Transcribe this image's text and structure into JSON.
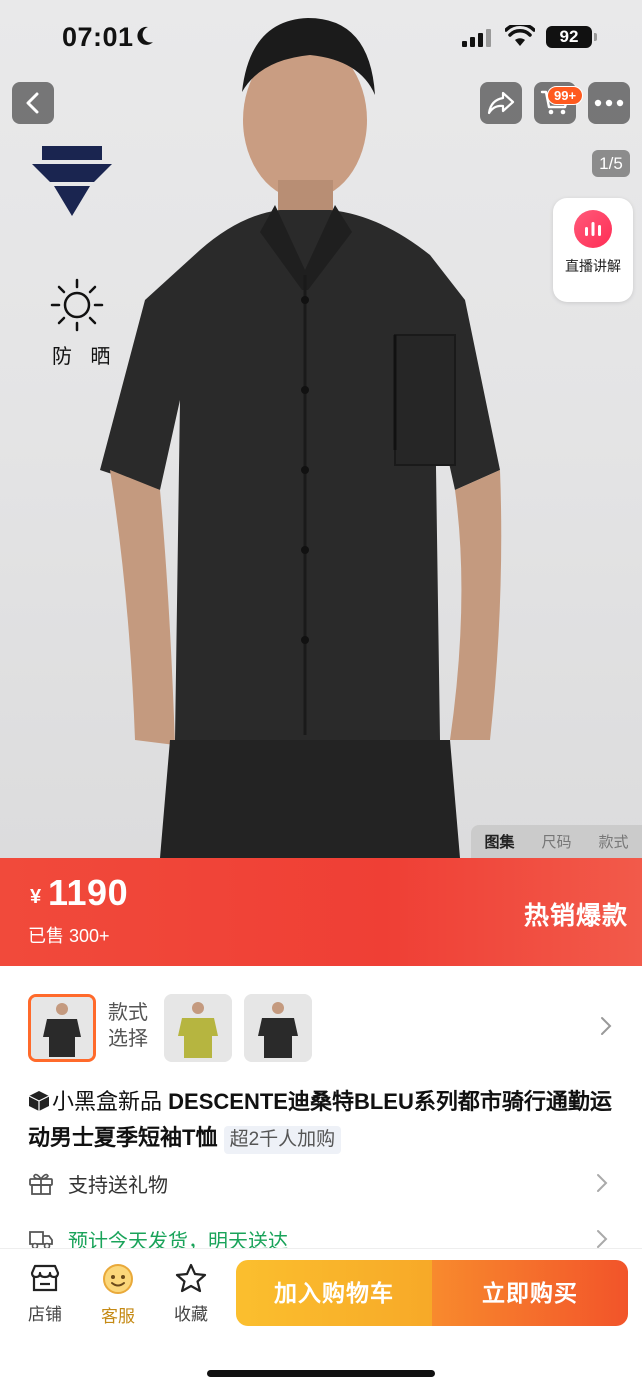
{
  "status_bar": {
    "time": "07:01",
    "battery": "92"
  },
  "nav": {
    "cart_badge": "99+",
    "page_indicator": "1/5",
    "live_label": "直播讲解"
  },
  "hero": {
    "feature_label": "防 晒",
    "image_tabs": [
      "图集",
      "尺码",
      "款式"
    ],
    "active_tab": "图集"
  },
  "price_bar": {
    "currency": "¥",
    "price": "1190",
    "sold": "已售 300+",
    "tag": "热销爆款"
  },
  "variants": {
    "label_line1": "款式",
    "label_line2": "选择",
    "count": 3
  },
  "product": {
    "brand_tag": "小黑盒新品",
    "title": "DESCENTE迪桑特BLEU系列都市骑行通勤运动男士夏季短袖T恤",
    "join_text": "超2千人加购"
  },
  "info_rows": {
    "gift": "支持送礼物",
    "delivery": "预计今天发货，明天送达"
  },
  "bottom_bar": {
    "store": "店铺",
    "service": "客服",
    "favorite": "收藏",
    "add_to_cart": "加入购物车",
    "buy_now": "立即购买"
  },
  "colors": {
    "accent": "#f14a3b",
    "cart_btn": "#f7a928",
    "buy_btn": "#f2542a",
    "variant_selected": "#ff6a2b"
  }
}
